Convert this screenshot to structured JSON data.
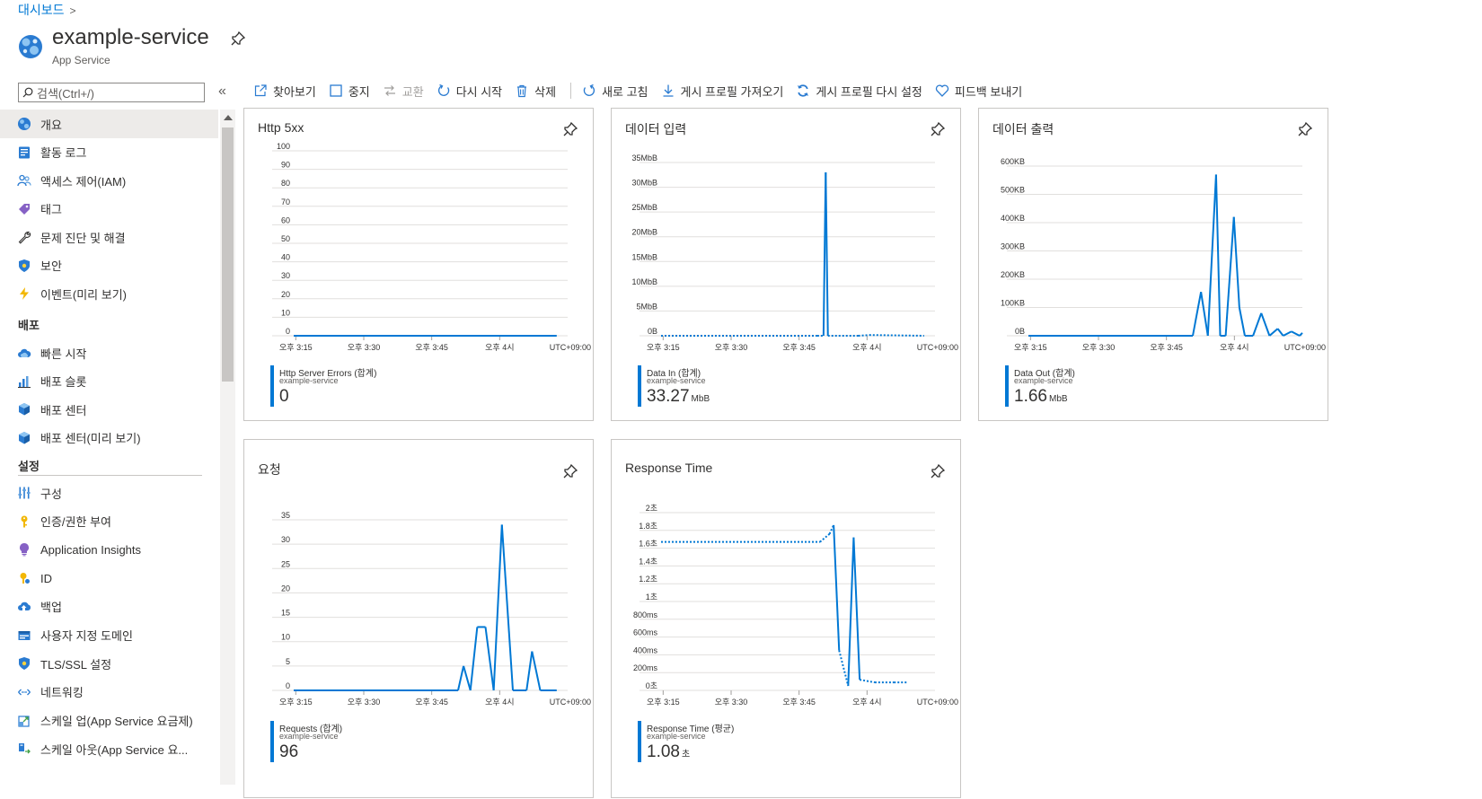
{
  "breadcrumb": {
    "label": "대시보드",
    "chevron": ">"
  },
  "header": {
    "title": "example-service",
    "subtitle": "App Service"
  },
  "search": {
    "placeholder": "검색(Ctrl+/)"
  },
  "collapse_glyph": "«",
  "toolbar": [
    {
      "icon": "browse-icon",
      "label": "찾아보기",
      "disabled": false
    },
    {
      "icon": "stop-icon",
      "label": "중지",
      "disabled": false
    },
    {
      "icon": "swap-icon",
      "label": "교환",
      "disabled": true
    },
    {
      "icon": "restart-icon",
      "label": "다시 시작",
      "disabled": false
    },
    {
      "icon": "delete-icon",
      "label": "삭제",
      "disabled": false
    },
    {
      "icon": "refresh-icon",
      "label": "새로 고침",
      "disabled": false
    },
    {
      "icon": "download-icon",
      "label": "게시 프로필 가져오기",
      "disabled": false
    },
    {
      "icon": "reset-icon",
      "label": "게시 프로필 다시 설정",
      "disabled": false
    },
    {
      "icon": "heart-icon",
      "label": "피드백 보내기",
      "disabled": false
    }
  ],
  "sidebar": {
    "items": [
      {
        "label": "개요",
        "icon": "overview-icon",
        "active": true
      },
      {
        "label": "활동 로그",
        "icon": "activity-log-icon"
      },
      {
        "label": "액세스 제어(IAM)",
        "icon": "people-icon"
      },
      {
        "label": "태그",
        "icon": "tag-icon"
      },
      {
        "label": "문제 진단 및 해결",
        "icon": "wrench-icon"
      },
      {
        "label": "보안",
        "icon": "shield-icon"
      },
      {
        "label": "이벤트(미리 보기)",
        "icon": "lightning-icon"
      }
    ],
    "deploy_section": "배포",
    "deploy_items": [
      {
        "label": "빠른 시작",
        "icon": "cloud-icon"
      },
      {
        "label": "배포 슬롯",
        "icon": "slots-icon"
      },
      {
        "label": "배포 센터",
        "icon": "cube-icon"
      },
      {
        "label": "배포 센터(미리 보기)",
        "icon": "cube-icon"
      }
    ],
    "settings_section": "설정",
    "settings_items": [
      {
        "label": "구성",
        "icon": "config-icon"
      },
      {
        "label": "인증/권한 부여",
        "icon": "key-icon"
      },
      {
        "label": "Application Insights",
        "icon": "bulb-icon"
      },
      {
        "label": "ID",
        "icon": "identity-icon"
      },
      {
        "label": "백업",
        "icon": "backup-icon"
      },
      {
        "label": "사용자 지정 도메인",
        "icon": "domain-icon"
      },
      {
        "label": "TLS/SSL 설정",
        "icon": "tls-shield-icon"
      },
      {
        "label": "네트워킹",
        "icon": "network-icon"
      },
      {
        "label": "스케일 업(App Service 요금제)",
        "icon": "scale-up-icon"
      },
      {
        "label": "스케일 아웃(App Service 요...",
        "icon": "scale-out-icon"
      }
    ]
  },
  "colors": {
    "accent": "#0078d4",
    "gridline": "#e1dfdd"
  },
  "chart_data": [
    {
      "type": "line",
      "title": "Http 5xx",
      "xticks": [
        "오후 3:15",
        "오후 3:30",
        "오후 3:45",
        "오후 4시"
      ],
      "timezone": "UTC+09:00",
      "yticks": [
        "100",
        "90",
        "80",
        "70",
        "60",
        "50",
        "40",
        "30",
        "20",
        "10",
        "0"
      ],
      "ylim": [
        0,
        100
      ],
      "series": [
        {
          "name": "Http Server Errors (합계)",
          "x": [
            0,
            0.96
          ],
          "values": [
            0,
            0
          ],
          "dashed_ranges": []
        }
      ],
      "legend": {
        "name": "Http Server Errors (합계)",
        "resource": "example-service",
        "value": "0",
        "unit": ""
      }
    },
    {
      "type": "line",
      "title": "데이터 입력",
      "xticks": [
        "오후 3:15",
        "오후 3:30",
        "오후 3:45",
        "오후 4시"
      ],
      "timezone": "UTC+09:00",
      "yticks": [
        "35MbB",
        "30MbB",
        "25MbB",
        "20MbB",
        "15MbB",
        "10MbB",
        "5MbB",
        "0B"
      ],
      "ylim": [
        0,
        35
      ],
      "series": [
        {
          "name": "Data In (합계)",
          "x": [
            0,
            0.57,
            0.593,
            0.601,
            0.609,
            0.72,
            0.76,
            0.96
          ],
          "values": [
            0,
            0,
            0,
            33,
            0,
            0,
            0.15,
            0
          ],
          "dashed_ranges": [
            [
              0,
              0.593
            ],
            [
              0.609,
              0.96
            ]
          ]
        }
      ],
      "legend": {
        "name": "Data In (합계)",
        "resource": "example-service",
        "value": "33.27",
        "unit": "MbB"
      }
    },
    {
      "type": "line",
      "title": "데이터 출력",
      "xticks": [
        "오후 3:15",
        "오후 3:30",
        "오후 3:45",
        "오후 4시"
      ],
      "timezone": "UTC+09:00",
      "yticks": [
        "600KB",
        "500KB",
        "400KB",
        "300KB",
        "200KB",
        "100KB",
        "0B"
      ],
      "ylim": [
        0,
        600
      ],
      "series": [
        {
          "name": "Data Out (합계)",
          "x": [
            0,
            0.6,
            0.63,
            0.655,
            0.685,
            0.7,
            0.72,
            0.75,
            0.77,
            0.79,
            0.82,
            0.85,
            0.88,
            0.91,
            0.93,
            0.96,
            0.99,
            1.0
          ],
          "values": [
            0,
            0,
            155,
            0,
            570,
            0,
            0,
            420,
            100,
            0,
            0,
            80,
            0,
            25,
            0,
            15,
            0,
            10
          ],
          "dashed_ranges": []
        }
      ],
      "legend": {
        "name": "Data Out (합계)",
        "resource": "example-service",
        "value": "1.66",
        "unit": "MbB"
      }
    },
    {
      "type": "line",
      "title": "요청",
      "xticks": [
        "오후 3:15",
        "오후 3:30",
        "오후 3:45",
        "오후 4시"
      ],
      "timezone": "UTC+09:00",
      "yticks": [
        "35",
        "30",
        "25",
        "20",
        "15",
        "10",
        "5",
        "0"
      ],
      "ylim": [
        0,
        35
      ],
      "series": [
        {
          "name": "Requests (합계)",
          "x": [
            0,
            0.6,
            0.62,
            0.645,
            0.67,
            0.7,
            0.73,
            0.76,
            0.8,
            0.85,
            0.87,
            0.9,
            0.96
          ],
          "values": [
            0,
            0,
            5,
            0,
            13,
            13,
            0,
            34,
            0,
            0,
            8,
            0,
            0
          ],
          "dashed_ranges": []
        }
      ],
      "legend": {
        "name": "Requests (합계)",
        "resource": "example-service",
        "value": "96",
        "unit": ""
      }
    },
    {
      "type": "line",
      "title": "Response Time",
      "xticks": [
        "오후 3:15",
        "오후 3:30",
        "오후 3:45",
        "오후 4시"
      ],
      "timezone": "UTC+09:00",
      "yticks": [
        "2초",
        "1.8초",
        "1.6초",
        "1.4초",
        "1.2초",
        "1초",
        "800ms",
        "600ms",
        "400ms",
        "200ms",
        "0초"
      ],
      "ylim": [
        0,
        2.0
      ],
      "series": [
        {
          "name": "Response Time (평균)",
          "x": [
            0,
            0.58,
            0.615,
            0.63,
            0.65,
            0.683,
            0.703,
            0.725,
            0.78,
            0.85,
            0.9
          ],
          "values": [
            1.67,
            1.67,
            1.76,
            1.86,
            0.45,
            0.05,
            1.72,
            0.12,
            0.09,
            0.09,
            0.09
          ],
          "dashed_ranges": [
            [
              0,
              0.63
            ],
            [
              0.65,
              0.683
            ],
            [
              0.725,
              0.9
            ]
          ]
        }
      ],
      "legend": {
        "name": "Response Time (평균)",
        "resource": "example-service",
        "value": "1.08",
        "unit": "초"
      }
    }
  ]
}
